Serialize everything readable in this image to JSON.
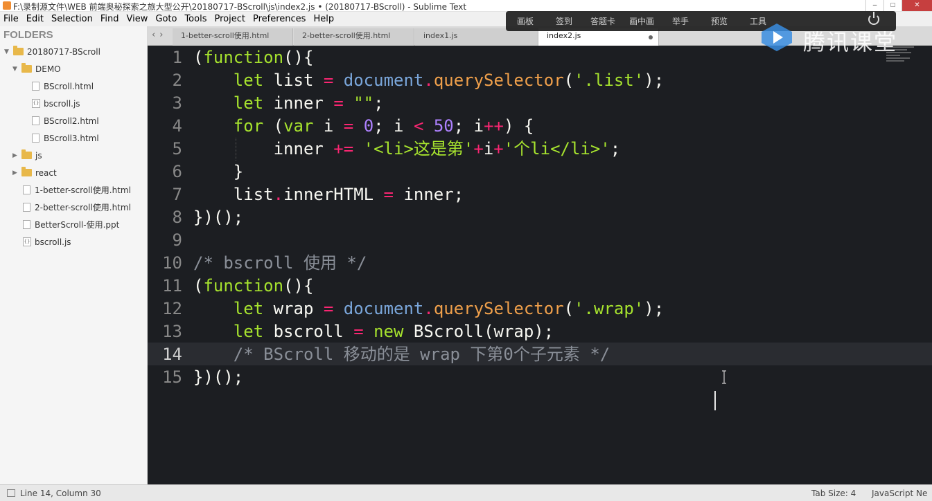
{
  "window": {
    "title": "F:\\录制源文件\\WEB 前端奥秘探索之旅大型公开\\20180717-BScroll\\js\\index2.js • (20180717-BScroll) - Sublime Text"
  },
  "menu": [
    "File",
    "Edit",
    "Selection",
    "Find",
    "View",
    "Goto",
    "Tools",
    "Project",
    "Preferences",
    "Help"
  ],
  "overlay_toolbar": {
    "items": [
      "画板",
      "签到",
      "答题卡",
      "画中画",
      "举手",
      "预览",
      "工具"
    ]
  },
  "watermark": {
    "text": "腾讯课堂"
  },
  "sidebar": {
    "header": "FOLDERS",
    "items": [
      {
        "label": "20180717-BScroll",
        "type": "folder-open"
      },
      {
        "label": "DEMO",
        "type": "folder-open"
      },
      {
        "label": "BScroll.html",
        "type": "file"
      },
      {
        "label": "bscroll.js",
        "type": "js"
      },
      {
        "label": "BScroll2.html",
        "type": "file"
      },
      {
        "label": "BScroll3.html",
        "type": "file"
      },
      {
        "label": "js",
        "type": "folder"
      },
      {
        "label": "react",
        "type": "folder"
      },
      {
        "label": "1-better-scroll使用.html",
        "type": "file"
      },
      {
        "label": "2-better-scroll使用.html",
        "type": "file"
      },
      {
        "label": "BetterScroll-使用.ppt",
        "type": "file"
      },
      {
        "label": "bscroll.js",
        "type": "js"
      }
    ]
  },
  "tabs": [
    {
      "label": "1-better-scroll使用.html",
      "active": false
    },
    {
      "label": "2-better-scroll使用.html",
      "active": false
    },
    {
      "label": "index1.js",
      "active": false
    },
    {
      "label": "index2.js",
      "active": true
    }
  ],
  "editor": {
    "line_numbers": [
      "1",
      "2",
      "3",
      "4",
      "5",
      "6",
      "7",
      "8",
      "9",
      "10",
      "11",
      "12",
      "13",
      "14",
      "15"
    ],
    "current_line": 14,
    "lines": [
      [
        [
          "pl",
          "("
        ],
        [
          "kw2",
          "function"
        ],
        [
          "pl",
          "(){"
        ]
      ],
      [
        [
          "pl",
          "    "
        ],
        [
          "kw2",
          "let"
        ],
        [
          "pl",
          " list "
        ],
        [
          "op",
          "="
        ],
        [
          "pl",
          " "
        ],
        [
          "obj",
          "document"
        ],
        [
          "op",
          "."
        ],
        [
          "fn",
          "querySelector"
        ],
        [
          "pl",
          "("
        ],
        [
          "str",
          "'.list'"
        ],
        [
          "pl",
          ");"
        ]
      ],
      [
        [
          "pl",
          "    "
        ],
        [
          "kw2",
          "let"
        ],
        [
          "pl",
          " inner "
        ],
        [
          "op",
          "="
        ],
        [
          "pl",
          " "
        ],
        [
          "str",
          "\"\""
        ],
        [
          "pl",
          ";"
        ]
      ],
      [
        [
          "pl",
          "    "
        ],
        [
          "kw2",
          "for"
        ],
        [
          "pl",
          " ("
        ],
        [
          "kw2",
          "var"
        ],
        [
          "pl",
          " i "
        ],
        [
          "op",
          "="
        ],
        [
          "pl",
          " "
        ],
        [
          "num",
          "0"
        ],
        [
          "pl",
          "; i "
        ],
        [
          "op",
          "<"
        ],
        [
          "pl",
          " "
        ],
        [
          "num",
          "50"
        ],
        [
          "pl",
          "; i"
        ],
        [
          "op",
          "++"
        ],
        [
          "pl",
          ") {"
        ]
      ],
      [
        [
          "pl",
          "        inner "
        ],
        [
          "op",
          "+="
        ],
        [
          "pl",
          " "
        ],
        [
          "str",
          "'<li>这是第'"
        ],
        [
          "op",
          "+"
        ],
        [
          "pl",
          "i"
        ],
        [
          "op",
          "+"
        ],
        [
          "str",
          "'个li</li>'"
        ],
        [
          "pl",
          ";"
        ]
      ],
      [
        [
          "pl",
          "    }"
        ]
      ],
      [
        [
          "pl",
          "    list"
        ],
        [
          "op",
          "."
        ],
        [
          "pl",
          "innerHTML "
        ],
        [
          "op",
          "="
        ],
        [
          "pl",
          " inner;"
        ]
      ],
      [
        [
          "pl",
          "})();"
        ]
      ],
      [
        [
          "pl",
          ""
        ]
      ],
      [
        [
          "cm",
          "/* bscroll 使用 */"
        ]
      ],
      [
        [
          "pl",
          "("
        ],
        [
          "kw2",
          "function"
        ],
        [
          "pl",
          "(){"
        ]
      ],
      [
        [
          "pl",
          "    "
        ],
        [
          "kw2",
          "let"
        ],
        [
          "pl",
          " wrap "
        ],
        [
          "op",
          "="
        ],
        [
          "pl",
          " "
        ],
        [
          "obj",
          "document"
        ],
        [
          "op",
          "."
        ],
        [
          "fn",
          "querySelector"
        ],
        [
          "pl",
          "("
        ],
        [
          "str",
          "'.wrap'"
        ],
        [
          "pl",
          ");"
        ]
      ],
      [
        [
          "pl",
          "    "
        ],
        [
          "kw2",
          "let"
        ],
        [
          "pl",
          " bscroll "
        ],
        [
          "op",
          "="
        ],
        [
          "pl",
          " "
        ],
        [
          "kw2",
          "new"
        ],
        [
          "pl",
          " BScroll(wrap);"
        ]
      ],
      [
        [
          "pl",
          "    "
        ],
        [
          "cm",
          "/* BScroll 移动的是 wrap 下第0个子元素 */"
        ]
      ],
      [
        [
          "pl",
          "})();"
        ]
      ]
    ],
    "colors": {
      "keyword": "#a6e22e",
      "function": "#f0a04b",
      "string": "#a6e22e",
      "number": "#ae81ff",
      "operator": "#f92672",
      "comment": "#8a8f98",
      "background": "#1c1e22"
    }
  },
  "statusbar": {
    "position": "Line 14, Column 30",
    "tab_size": "Tab Size: 4",
    "syntax": "JavaScript Ne"
  }
}
